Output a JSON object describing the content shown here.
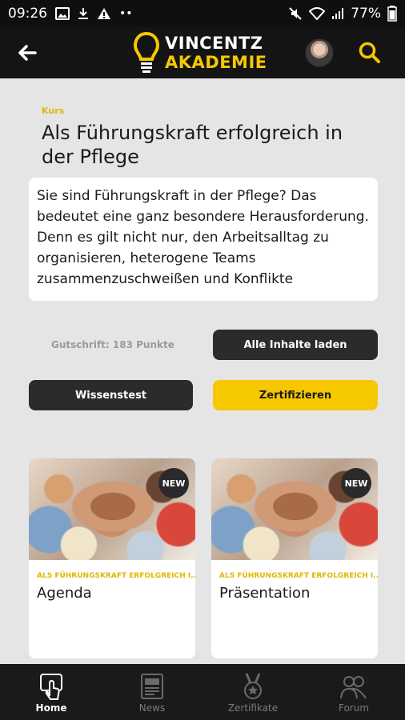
{
  "status_bar": {
    "time": "09:26",
    "battery": "77%"
  },
  "header": {
    "logo_line1": "VINCENTZ",
    "logo_line2": "AKADEMIE"
  },
  "course": {
    "eyebrow": "Kurs",
    "title": "Als Führungskraft erfolgreich in der Pflege",
    "description": "Sie sind Führungskraft in der Pflege? Das bedeutet eine ganz besondere Herausforderung. Denn es gilt nicht nur, den Arbeitsalltag zu organisieren, heterogene Teams zusammenzuschweißen und Konflikte"
  },
  "actions": {
    "credit": "Gutschrift: 183 Punkte",
    "load_all": "Alle Inhalte laden",
    "quiz": "Wissenstest",
    "certify": "Zertifizieren"
  },
  "cards": [
    {
      "badge": "NEW",
      "eyebrow": "ALS FÜHRUNGSKRAFT ERFOLGREICH I...",
      "name": "Agenda"
    },
    {
      "badge": "NEW",
      "eyebrow": "ALS FÜHRUNGSKRAFT ERFOLGREICH I...",
      "name": "Präsentation"
    }
  ],
  "bottom_nav": [
    {
      "label": "Home",
      "icon": "home-touch-icon",
      "active": true
    },
    {
      "label": "News",
      "icon": "newspaper-icon",
      "active": false
    },
    {
      "label": "Zertifikate",
      "icon": "medal-icon",
      "active": false
    },
    {
      "label": "Forum",
      "icon": "people-icon",
      "active": false
    }
  ],
  "colors": {
    "accent": "#f5c800",
    "dark": "#141414",
    "background": "#e5e5e5"
  }
}
